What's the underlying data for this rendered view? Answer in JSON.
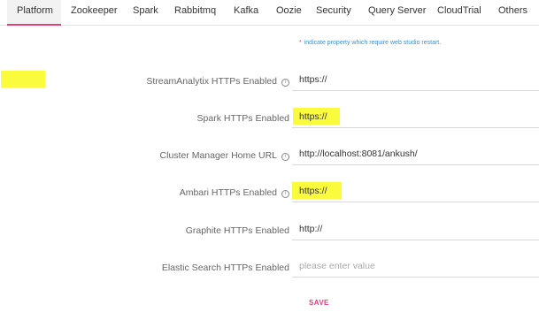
{
  "tabs": [
    {
      "label": "Platform",
      "active": true
    },
    {
      "label": "Zookeeper"
    },
    {
      "label": "Spark"
    },
    {
      "label": "Rabbitmq"
    },
    {
      "label": "Kafka"
    },
    {
      "label": "Oozie"
    },
    {
      "label": "Security"
    },
    {
      "label": "Query Server"
    },
    {
      "label": "CloudTrial"
    },
    {
      "label": "Others"
    }
  ],
  "note": {
    "star": "*",
    "text": "indicate property which require web studio restart."
  },
  "fields": [
    {
      "label": "StreamAnalytix HTTPs Enabled",
      "value": "https://",
      "highlighted": true
    },
    {
      "label": "Spark HTTPs Enabled",
      "value": "https://",
      "highlighted": true
    },
    {
      "label": "Cluster Manager Home URL",
      "value": "http://localhost:8081/ankush/"
    },
    {
      "label": "Ambari HTTPs Enabled",
      "value": "https://",
      "highlighted": true
    },
    {
      "label": "Graphite HTTPs Enabled",
      "value": "http://"
    },
    {
      "label": "Elastic Search HTTPs Enabled",
      "value": "",
      "placeholder": "please enter value"
    }
  ],
  "save_label": "SAVE",
  "colors": {
    "accent": "#e0407b",
    "highlight": "#fbfb3e",
    "note": "#3b8fd6"
  }
}
